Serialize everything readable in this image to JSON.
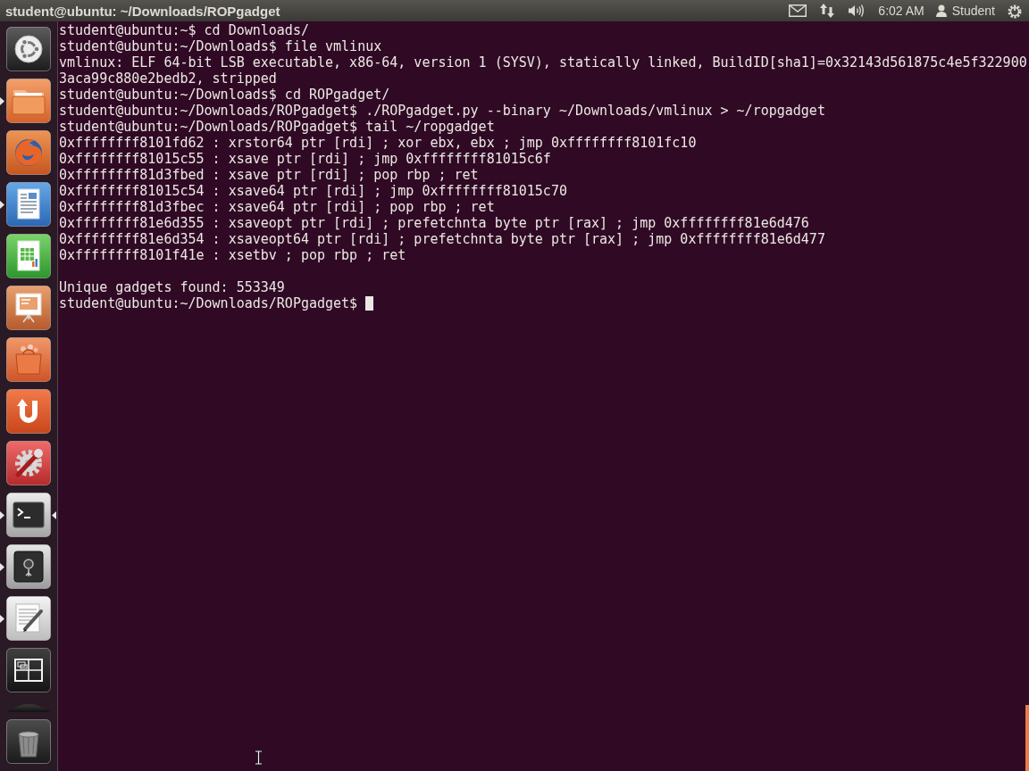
{
  "top_panel": {
    "window_title": "student@ubuntu: ~/Downloads/ROPgadget",
    "indicators": [
      {
        "kind": "mail"
      },
      {
        "kind": "network"
      },
      {
        "kind": "sound"
      },
      {
        "kind": "clock",
        "label": "6:02 AM"
      },
      {
        "kind": "user",
        "label": "Student"
      },
      {
        "kind": "session"
      }
    ]
  },
  "launcher": {
    "items": [
      {
        "kind": "dash",
        "running": false,
        "focused": false
      },
      {
        "kind": "files",
        "running": true,
        "focused": false
      },
      {
        "kind": "browser",
        "running": false,
        "focused": false
      },
      {
        "kind": "writer",
        "running": true,
        "focused": false
      },
      {
        "kind": "calc",
        "running": false,
        "focused": false
      },
      {
        "kind": "impress",
        "running": false,
        "focused": false
      },
      {
        "kind": "software",
        "running": false,
        "focused": false
      },
      {
        "kind": "ubuntuone",
        "running": false,
        "focused": false
      },
      {
        "kind": "settings",
        "running": false,
        "focused": false
      },
      {
        "kind": "terminal",
        "running": true,
        "focused": true
      },
      {
        "kind": "safe",
        "running": true,
        "focused": false
      },
      {
        "kind": "editor",
        "running": true,
        "focused": false
      },
      {
        "kind": "workspaces",
        "running": false,
        "focused": false
      },
      {
        "kind": "folded",
        "running": false,
        "focused": false
      },
      {
        "kind": "trash",
        "running": false,
        "focused": false
      }
    ]
  },
  "terminal": {
    "blocks": [
      {
        "lines": [
          "student@ubuntu:~$ cd Downloads/",
          "student@ubuntu:~/Downloads$ file vmlinux",
          "vmlinux: ELF 64-bit LSB executable, x86-64, version 1 (SYSV), statically linked, BuildID[sha1]=0x32143d561875c4e5f322900",
          "3aca99c880e2bedb2, stripped",
          "student@ubuntu:~/Downloads$ cd ROPgadget/",
          "student@ubuntu:~/Downloads/ROPgadget$ ./ROPgadget.py --binary ~/Downloads/vmlinux > ~/ropgadget",
          "student@ubuntu:~/Downloads/ROPgadget$ tail ~/ropgadget",
          "0xffffffff8101fd62 : xrstor64 ptr [rdi] ; xor ebx, ebx ; jmp 0xffffffff8101fc10",
          "0xffffffff81015c55 : xsave ptr [rdi] ; jmp 0xffffffff81015c6f",
          "0xffffffff81d3fbed : xsave ptr [rdi] ; pop rbp ; ret",
          "0xffffffff81015c54 : xsave64 ptr [rdi] ; jmp 0xffffffff81015c70",
          "0xffffffff81d3fbec : xsave64 ptr [rdi] ; pop rbp ; ret",
          "0xffffffff81e6d355 : xsaveopt ptr [rdi] ; prefetchnta byte ptr [rax] ; jmp 0xffffffff81e6d476",
          "0xffffffff81e6d354 : xsaveopt64 ptr [rdi] ; prefetchnta byte ptr [rax] ; jmp 0xffffffff81e6d477",
          "0xffffffff8101f41e : xsetbv ; pop rbp ; ret"
        ]
      },
      {
        "lines": [
          "Unique gadgets found: 553349",
          "student@ubuntu:~/Downloads/ROPgadget$"
        ]
      }
    ],
    "cursor": true
  }
}
